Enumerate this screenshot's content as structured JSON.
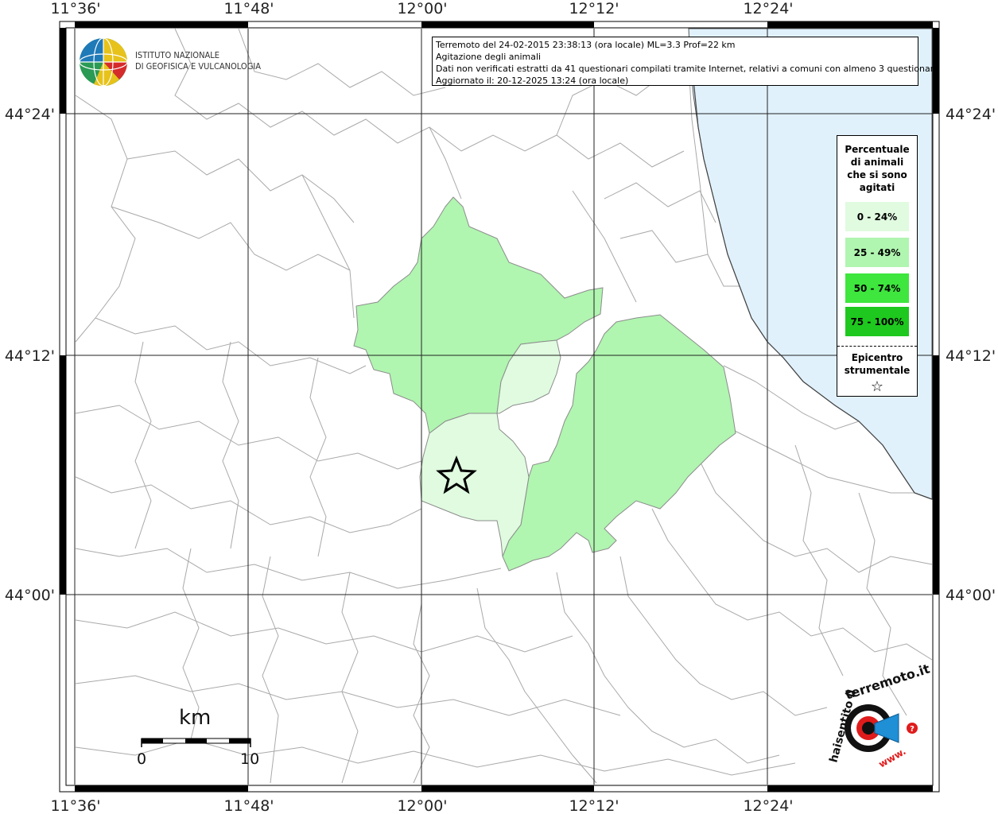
{
  "info": {
    "line1": "Terremoto del 24-02-2015 23:38:13 (ora locale) ML=3.3 Prof=22 km",
    "line2": "Agitazione degli animali",
    "line3": "Dati non verificati estratti da 41 questionari compilati tramite Internet, relativi a comuni con almeno 3 questionari.",
    "line4": "Aggiornato il: 20-12-2025 13:24 (ora locale)"
  },
  "logo": {
    "line1": "ISTITUTO NAZIONALE",
    "line2": "DI GEOFISICA E VULCANOLOGIA"
  },
  "axes": {
    "lon_top": [
      "11°36'",
      "11°48'",
      "12°00'",
      "12°12'",
      "12°24'"
    ],
    "lon_bottom": [
      "11°36'",
      "11°48'",
      "12°00'",
      "12°12'",
      "12°24'"
    ],
    "lat_left": [
      "44°24'",
      "44°12'",
      "44°00'"
    ],
    "lat_right": [
      "44°24'",
      "44°12'",
      "44°00'"
    ]
  },
  "legend": {
    "title_lines": [
      "Percentuale",
      "di animali",
      "che si sono",
      "agitati"
    ],
    "classes": [
      {
        "label": "0 - 24%",
        "color": "#e0fbe0"
      },
      {
        "label": "25 - 49%",
        "color": "#b0f5b0"
      },
      {
        "label": "50 - 74%",
        "color": "#3ee63e"
      },
      {
        "label": "75 - 100%",
        "color": "#1ec81e"
      }
    ],
    "epicenter_lines": [
      "Epicentro",
      "strumentale"
    ],
    "star": "☆"
  },
  "scale": {
    "unit": "km",
    "min": "0",
    "max": "10"
  },
  "badge": {
    "text_top": "terremoto.it",
    "text_left": "haisentito il",
    "text_www": "www.",
    "icon": "speaker-icon"
  },
  "colors": {
    "sea": "#e0f1fc",
    "borders": "#999999",
    "class_0_24": "#e0fbe0",
    "class_25_49": "#b0f5b0"
  }
}
